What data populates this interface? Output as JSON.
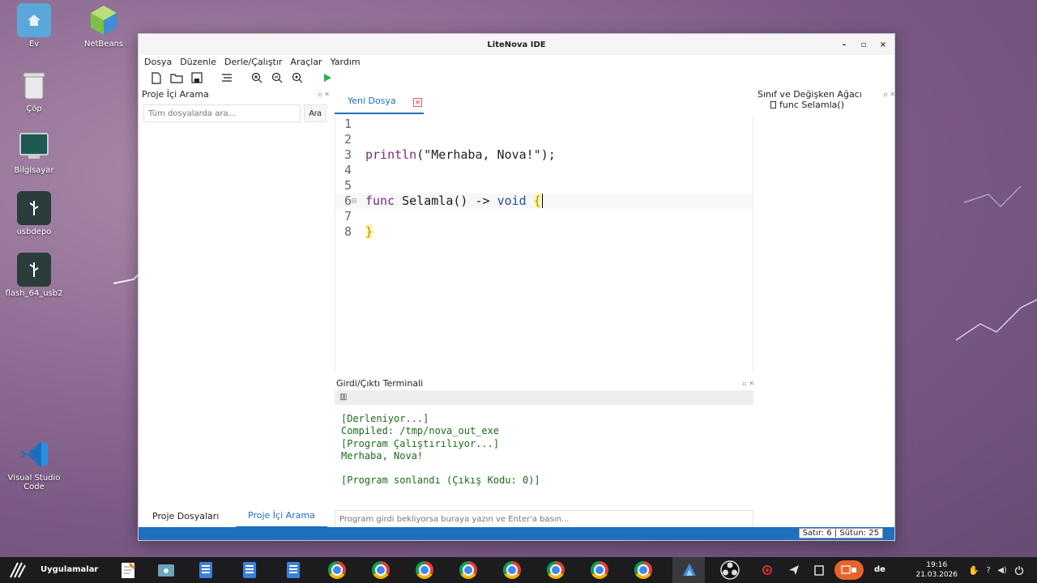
{
  "desktop": {
    "icons": [
      {
        "label": "Ev"
      },
      {
        "label": "NetBeans"
      },
      {
        "label": "Çöp"
      },
      {
        "label": "Bilgisayar"
      },
      {
        "label": "usbdepo"
      },
      {
        "label": "flash_64_usb2"
      },
      {
        "label": "Visual Studio Code"
      }
    ]
  },
  "window": {
    "title": "LiteNova IDE",
    "controls": {
      "minimize": "–",
      "maximize": "▫",
      "close": "×"
    }
  },
  "menu": [
    "Dosya",
    "Düzenle",
    "Derle/Çalıştır",
    "Araçlar",
    "Yardım"
  ],
  "toolbar": {
    "icons": [
      "new-file-icon",
      "open-folder-icon",
      "save-icon",
      "format-icon",
      "zoom-in-icon",
      "zoom-out-icon",
      "zoom-reset-icon",
      "run-icon"
    ]
  },
  "left_panel": {
    "title": "Proje İçi Arama",
    "search_placeholder": "Tüm dosyalarda ara...",
    "search_button": "Ara"
  },
  "editor": {
    "tab_label": "Yeni Dosya",
    "lines": [
      {
        "num": "1",
        "text": ""
      },
      {
        "num": "2",
        "text": ""
      },
      {
        "num": "3",
        "text": "println(\"Merhaba, Nova!\");"
      },
      {
        "num": "4",
        "text": ""
      },
      {
        "num": "5",
        "text": ""
      },
      {
        "num": "6",
        "text": "func Selamla() -> void {"
      },
      {
        "num": "7",
        "text": ""
      },
      {
        "num": "8",
        "text": "}"
      }
    ],
    "tokens": {
      "l3_fn": "println",
      "l3_rest": "(\"Merhaba, Nova!\");",
      "l6_kw": "func",
      "l6_mid": " Selamla() -> ",
      "l6_void": "void",
      "l6_brace": "{",
      "l8_brace": "}"
    }
  },
  "right_panel": {
    "title": "Sınıf ve Değişken Ağacı",
    "item": "func Selamla()"
  },
  "terminal": {
    "title": "Girdi/Çıktı Terminali",
    "output": "[Derleniyor...]\nCompiled: /tmp/nova_out_exe\n[Program Çalıştırılıyor...]\nMerhaba, Nova!\n\n[Program sonlandı (Çıkış Kodu: 0)]",
    "input_placeholder": "Program girdi bekliyorsa buraya yazın ve Enter'a basın..."
  },
  "bottom_tabs": [
    {
      "label": "Proje Dosyaları",
      "active": false
    },
    {
      "label": "Proje İçi Arama",
      "active": true
    }
  ],
  "status": {
    "position": "Satır: 6 | Sütun: 25"
  },
  "taskbar": {
    "apps_label": "Uygulamalar",
    "keyboard_layout": "de",
    "time": "19:16",
    "date": "21.03.2026"
  },
  "colors": {
    "accent": "#1e6fbf",
    "terminal_text": "#1a6b1a",
    "taskbar": "#1c1c1e"
  }
}
